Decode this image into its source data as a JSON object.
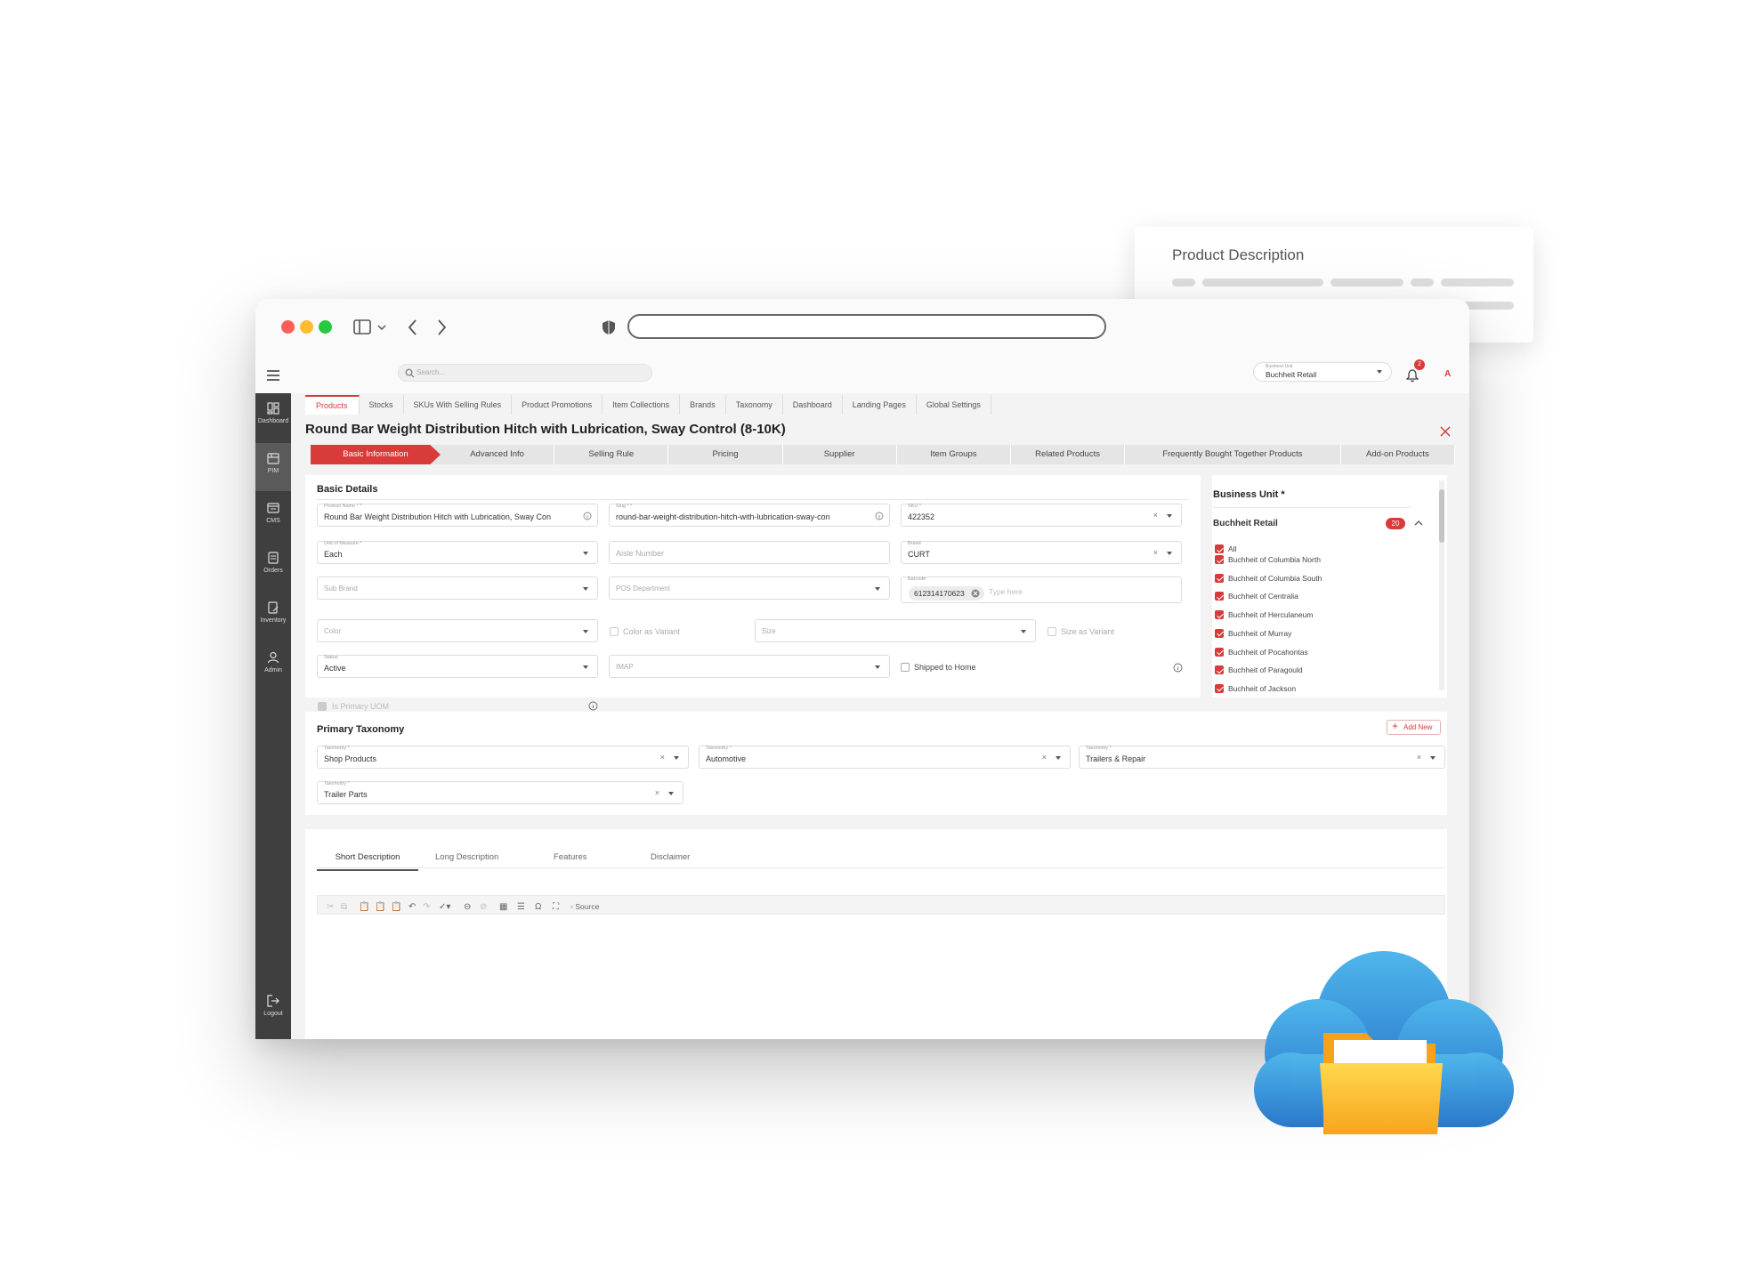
{
  "floating_card": {
    "title": "Product Description"
  },
  "topbar": {
    "search_placeholder": "Search...",
    "business_unit_label": "Business Unit",
    "business_unit_value": "Buchheit Retail",
    "notification_count": "2",
    "avatar_letter": "A"
  },
  "sidebar": {
    "items": [
      {
        "label": "Dashboard",
        "icon": "dashboard-icon"
      },
      {
        "label": "PIM",
        "icon": "pim-icon"
      },
      {
        "label": "CMS",
        "icon": "cms-icon"
      },
      {
        "label": "Orders",
        "icon": "orders-icon"
      },
      {
        "label": "Inventory",
        "icon": "inventory-icon"
      },
      {
        "label": "Admin",
        "icon": "admin-icon"
      }
    ],
    "logout_label": "Logout"
  },
  "nav_tabs": [
    "Products",
    "Stocks",
    "SKUs With Selling Rules",
    "Product Promotions",
    "Item Collections",
    "Brands",
    "Taxonomy",
    "Dashboard",
    "Landing Pages",
    "Global Settings"
  ],
  "page_title": "Round Bar Weight Distribution Hitch with Lubrication, Sway Control (8-10K)",
  "steps": [
    "Basic Information",
    "Advanced Info",
    "Selling Rule",
    "Pricing",
    "Supplier",
    "Item Groups",
    "Related Products",
    "Frequently Bought Together Products",
    "Add-on Products"
  ],
  "basic_details": {
    "title": "Basic Details",
    "product_name_label": "Product Name * *",
    "product_name_value": "Round Bar Weight Distribution Hitch with Lubrication, Sway Con",
    "slug_label": "Slug * *",
    "slug_value": "round-bar-weight-distribution-hitch-with-lubrication-sway-con",
    "sku_label": "SKU *",
    "sku_value": "422352",
    "uom_label": "Unit of Measure *",
    "uom_value": "Each",
    "aisle_placeholder": "Aisle Number",
    "brand_label": "Brand",
    "brand_value": "CURT",
    "sub_brand_placeholder": "Sub Brand",
    "pos_department_placeholder": "POS Department",
    "barcode_label": "Barcode",
    "barcode_chip": "612314170623",
    "barcode_placeholder": "Type here",
    "color_placeholder": "Color",
    "color_variant_label": "Color as Variant",
    "size_placeholder": "Size",
    "size_variant_label": "Size as Variant",
    "status_label": "Status",
    "status_value": "Active",
    "imap_placeholder": "IMAP",
    "shipped_label": "Shipped to Home",
    "primary_uom_label": "Is Primary UOM"
  },
  "business_unit": {
    "title": "Business Unit *",
    "group": "Buchheit Retail",
    "count": "20",
    "items": [
      "All",
      "Buchheit of Columbia North",
      "Buchheit of Columbia South",
      "Buchheit of Centralia",
      "Buchheit of Herculaneum",
      "Buchheit of Murray",
      "Buchheit of Pocahontas",
      "Buchheit of Paragould",
      "Buchheit of Jackson"
    ]
  },
  "primary_taxonomy": {
    "title": "Primary Taxonomy",
    "add_new": "Add New",
    "field_label": "Taxonomy *",
    "values": [
      "Shop Products",
      "Automotive",
      "Trailers & Repair",
      "Trailer Parts"
    ]
  },
  "editor": {
    "tabs": [
      "Short Description",
      "Long Description",
      "Features",
      "Disclaimer"
    ],
    "source_label": "Source"
  },
  "colors": {
    "accent": "#d93a3a",
    "sidebar": "#3f3f3f"
  }
}
